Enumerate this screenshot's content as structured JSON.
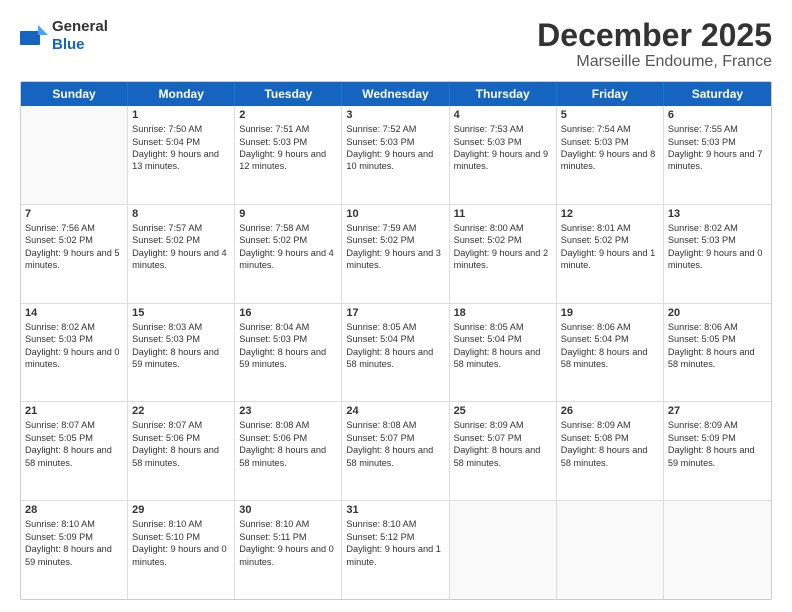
{
  "logo": {
    "line1": "General",
    "line2": "Blue"
  },
  "header": {
    "month": "December 2025",
    "location": "Marseille Endoume, France"
  },
  "days": [
    "Sunday",
    "Monday",
    "Tuesday",
    "Wednesday",
    "Thursday",
    "Friday",
    "Saturday"
  ],
  "rows": [
    [
      {
        "day": "",
        "empty": true
      },
      {
        "day": "1",
        "sunrise": "Sunrise: 7:50 AM",
        "sunset": "Sunset: 5:04 PM",
        "daylight": "Daylight: 9 hours and 13 minutes."
      },
      {
        "day": "2",
        "sunrise": "Sunrise: 7:51 AM",
        "sunset": "Sunset: 5:03 PM",
        "daylight": "Daylight: 9 hours and 12 minutes."
      },
      {
        "day": "3",
        "sunrise": "Sunrise: 7:52 AM",
        "sunset": "Sunset: 5:03 PM",
        "daylight": "Daylight: 9 hours and 10 minutes."
      },
      {
        "day": "4",
        "sunrise": "Sunrise: 7:53 AM",
        "sunset": "Sunset: 5:03 PM",
        "daylight": "Daylight: 9 hours and 9 minutes."
      },
      {
        "day": "5",
        "sunrise": "Sunrise: 7:54 AM",
        "sunset": "Sunset: 5:03 PM",
        "daylight": "Daylight: 9 hours and 8 minutes."
      },
      {
        "day": "6",
        "sunrise": "Sunrise: 7:55 AM",
        "sunset": "Sunset: 5:03 PM",
        "daylight": "Daylight: 9 hours and 7 minutes."
      }
    ],
    [
      {
        "day": "7",
        "sunrise": "Sunrise: 7:56 AM",
        "sunset": "Sunset: 5:02 PM",
        "daylight": "Daylight: 9 hours and 5 minutes."
      },
      {
        "day": "8",
        "sunrise": "Sunrise: 7:57 AM",
        "sunset": "Sunset: 5:02 PM",
        "daylight": "Daylight: 9 hours and 4 minutes."
      },
      {
        "day": "9",
        "sunrise": "Sunrise: 7:58 AM",
        "sunset": "Sunset: 5:02 PM",
        "daylight": "Daylight: 9 hours and 4 minutes."
      },
      {
        "day": "10",
        "sunrise": "Sunrise: 7:59 AM",
        "sunset": "Sunset: 5:02 PM",
        "daylight": "Daylight: 9 hours and 3 minutes."
      },
      {
        "day": "11",
        "sunrise": "Sunrise: 8:00 AM",
        "sunset": "Sunset: 5:02 PM",
        "daylight": "Daylight: 9 hours and 2 minutes."
      },
      {
        "day": "12",
        "sunrise": "Sunrise: 8:01 AM",
        "sunset": "Sunset: 5:02 PM",
        "daylight": "Daylight: 9 hours and 1 minute."
      },
      {
        "day": "13",
        "sunrise": "Sunrise: 8:02 AM",
        "sunset": "Sunset: 5:03 PM",
        "daylight": "Daylight: 9 hours and 0 minutes."
      }
    ],
    [
      {
        "day": "14",
        "sunrise": "Sunrise: 8:02 AM",
        "sunset": "Sunset: 5:03 PM",
        "daylight": "Daylight: 9 hours and 0 minutes."
      },
      {
        "day": "15",
        "sunrise": "Sunrise: 8:03 AM",
        "sunset": "Sunset: 5:03 PM",
        "daylight": "Daylight: 8 hours and 59 minutes."
      },
      {
        "day": "16",
        "sunrise": "Sunrise: 8:04 AM",
        "sunset": "Sunset: 5:03 PM",
        "daylight": "Daylight: 8 hours and 59 minutes."
      },
      {
        "day": "17",
        "sunrise": "Sunrise: 8:05 AM",
        "sunset": "Sunset: 5:04 PM",
        "daylight": "Daylight: 8 hours and 58 minutes."
      },
      {
        "day": "18",
        "sunrise": "Sunrise: 8:05 AM",
        "sunset": "Sunset: 5:04 PM",
        "daylight": "Daylight: 8 hours and 58 minutes."
      },
      {
        "day": "19",
        "sunrise": "Sunrise: 8:06 AM",
        "sunset": "Sunset: 5:04 PM",
        "daylight": "Daylight: 8 hours and 58 minutes."
      },
      {
        "day": "20",
        "sunrise": "Sunrise: 8:06 AM",
        "sunset": "Sunset: 5:05 PM",
        "daylight": "Daylight: 8 hours and 58 minutes."
      }
    ],
    [
      {
        "day": "21",
        "sunrise": "Sunrise: 8:07 AM",
        "sunset": "Sunset: 5:05 PM",
        "daylight": "Daylight: 8 hours and 58 minutes."
      },
      {
        "day": "22",
        "sunrise": "Sunrise: 8:07 AM",
        "sunset": "Sunset: 5:06 PM",
        "daylight": "Daylight: 8 hours and 58 minutes."
      },
      {
        "day": "23",
        "sunrise": "Sunrise: 8:08 AM",
        "sunset": "Sunset: 5:06 PM",
        "daylight": "Daylight: 8 hours and 58 minutes."
      },
      {
        "day": "24",
        "sunrise": "Sunrise: 8:08 AM",
        "sunset": "Sunset: 5:07 PM",
        "daylight": "Daylight: 8 hours and 58 minutes."
      },
      {
        "day": "25",
        "sunrise": "Sunrise: 8:09 AM",
        "sunset": "Sunset: 5:07 PM",
        "daylight": "Daylight: 8 hours and 58 minutes."
      },
      {
        "day": "26",
        "sunrise": "Sunrise: 8:09 AM",
        "sunset": "Sunset: 5:08 PM",
        "daylight": "Daylight: 8 hours and 58 minutes."
      },
      {
        "day": "27",
        "sunrise": "Sunrise: 8:09 AM",
        "sunset": "Sunset: 5:09 PM",
        "daylight": "Daylight: 8 hours and 59 minutes."
      }
    ],
    [
      {
        "day": "28",
        "sunrise": "Sunrise: 8:10 AM",
        "sunset": "Sunset: 5:09 PM",
        "daylight": "Daylight: 8 hours and 59 minutes."
      },
      {
        "day": "29",
        "sunrise": "Sunrise: 8:10 AM",
        "sunset": "Sunset: 5:10 PM",
        "daylight": "Daylight: 9 hours and 0 minutes."
      },
      {
        "day": "30",
        "sunrise": "Sunrise: 8:10 AM",
        "sunset": "Sunset: 5:11 PM",
        "daylight": "Daylight: 9 hours and 0 minutes."
      },
      {
        "day": "31",
        "sunrise": "Sunrise: 8:10 AM",
        "sunset": "Sunset: 5:12 PM",
        "daylight": "Daylight: 9 hours and 1 minute."
      },
      {
        "day": "",
        "empty": true
      },
      {
        "day": "",
        "empty": true
      },
      {
        "day": "",
        "empty": true
      }
    ]
  ]
}
